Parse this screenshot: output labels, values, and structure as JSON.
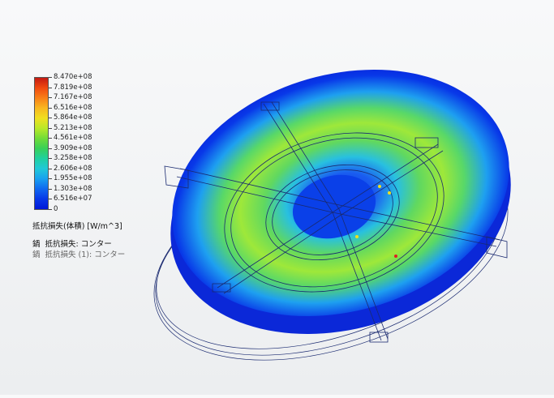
{
  "legend": {
    "ticks": [
      "8.470e+08",
      "7.819e+08",
      "7.167e+08",
      "6.516e+08",
      "5.864e+08",
      "5.213e+08",
      "4.561e+08",
      "3.909e+08",
      "3.258e+08",
      "2.606e+08",
      "1.955e+08",
      "1.303e+08",
      "6.516e+07",
      "0"
    ],
    "title": "抵抗損失(体積) [W/m^3]",
    "colors": [
      "#c41a12",
      "#f04a10",
      "#f88018",
      "#f8b820",
      "#f0e020",
      "#b8e828",
      "#70dc38",
      "#38d058",
      "#20d0a0",
      "#20c8d8",
      "#18a0f0",
      "#1068f0",
      "#0838e8",
      "#0018d8"
    ]
  },
  "plots": [
    {
      "icon": "鍋",
      "label": "抵抗損失: コンター",
      "active": true
    },
    {
      "icon": "鍋",
      "label": "抵抗損失 (1): コンター",
      "active": false
    }
  ],
  "model": {
    "outer_color": "#1438e8",
    "hot_color": "#78e040",
    "warm_color": "#30d0b0",
    "core_color": "#1850f0",
    "wire_color": "#1a2a70",
    "marker_colors": [
      "#f0e020",
      "#e02020"
    ]
  }
}
